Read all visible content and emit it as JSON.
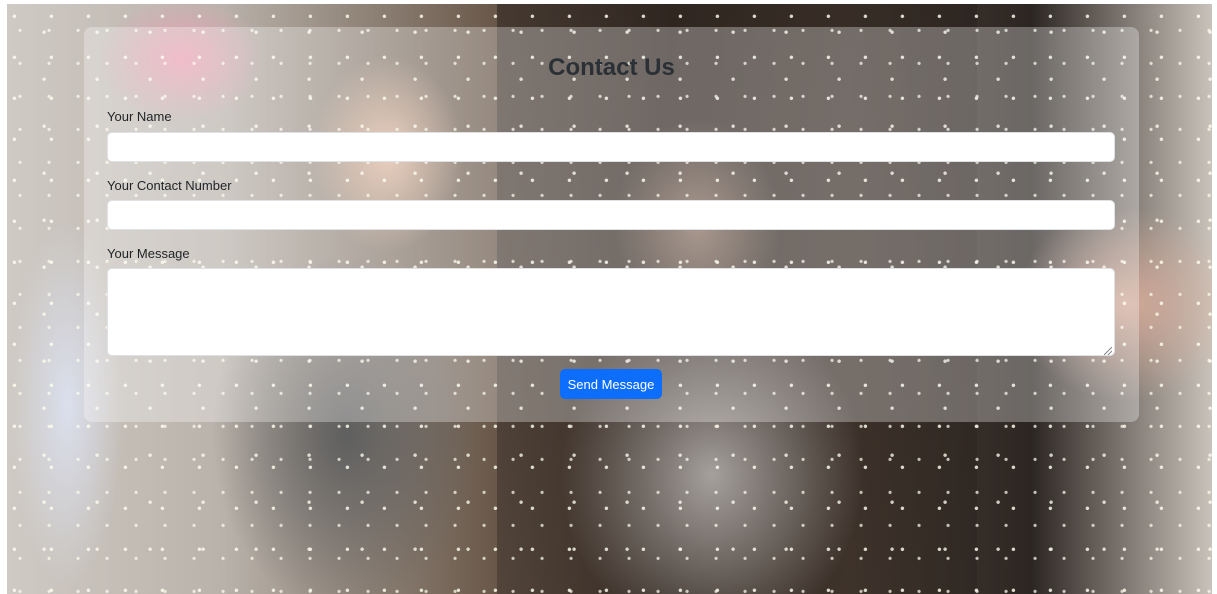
{
  "contact": {
    "title": "Contact Us",
    "name_label": "Your Name",
    "name_value": "",
    "phone_label": "Your Contact Number",
    "phone_value": "",
    "message_label": "Your Message",
    "message_value": "",
    "submit_label": "Send Message"
  },
  "colors": {
    "accent": "#0d6efd",
    "title_text": "#2b3036"
  },
  "icons": {
    "resize": "textarea-resize-handle-icon"
  }
}
